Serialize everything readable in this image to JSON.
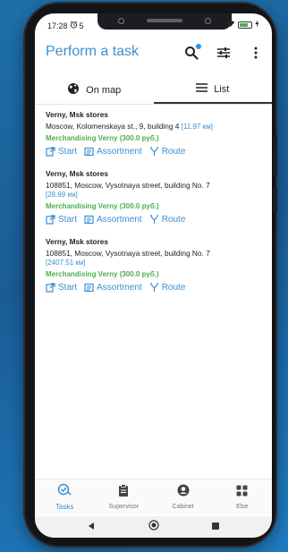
{
  "status_bar": {
    "time": "17:28",
    "alarm_icon": "alarm-icon",
    "extra": "5"
  },
  "app_bar": {
    "title": "Perform a task",
    "icons": [
      "search-icon",
      "filter-icon",
      "more-vert-icon"
    ]
  },
  "tabs": [
    {
      "label": "On map",
      "icon": "globe-icon",
      "active": false
    },
    {
      "label": "List",
      "icon": "list-icon",
      "active": true
    }
  ],
  "tasks": [
    {
      "title": "Verny, Msk stores",
      "address": "Moscow, Kolomenskaya st., 9, building 4",
      "distance": "[11.97 км]",
      "type": "Merchandising Verny (300.0 руб.)"
    },
    {
      "title": "Verny, Msk stores",
      "address": "108851, Moscow, Vysotnaya street, building No. 7",
      "distance": "[28.69 км]",
      "type": "Merchandising Verny (300.0 руб.)"
    },
    {
      "title": "Verny, Msk stores",
      "address": "108851, Moscow, Vysotnaya street, building No. 7",
      "distance": "[2407.51 км]",
      "type": "Merchandising Verny (300.0 руб.)"
    }
  ],
  "actions": {
    "start": "Start",
    "assortment": "Assortment",
    "route": "Route"
  },
  "bottom_nav": [
    {
      "label": "Tasks",
      "icon": "tasks-check-icon",
      "active": true
    },
    {
      "label": "Supervisor",
      "icon": "clipboard-icon",
      "active": false
    },
    {
      "label": "Cabinet",
      "icon": "account-icon",
      "active": false
    },
    {
      "label": "Else",
      "icon": "grid-icon",
      "active": false
    }
  ],
  "colors": {
    "accent": "#3a8fd2",
    "status_green": "#4caf50",
    "badge_blue": "#2196f3"
  }
}
